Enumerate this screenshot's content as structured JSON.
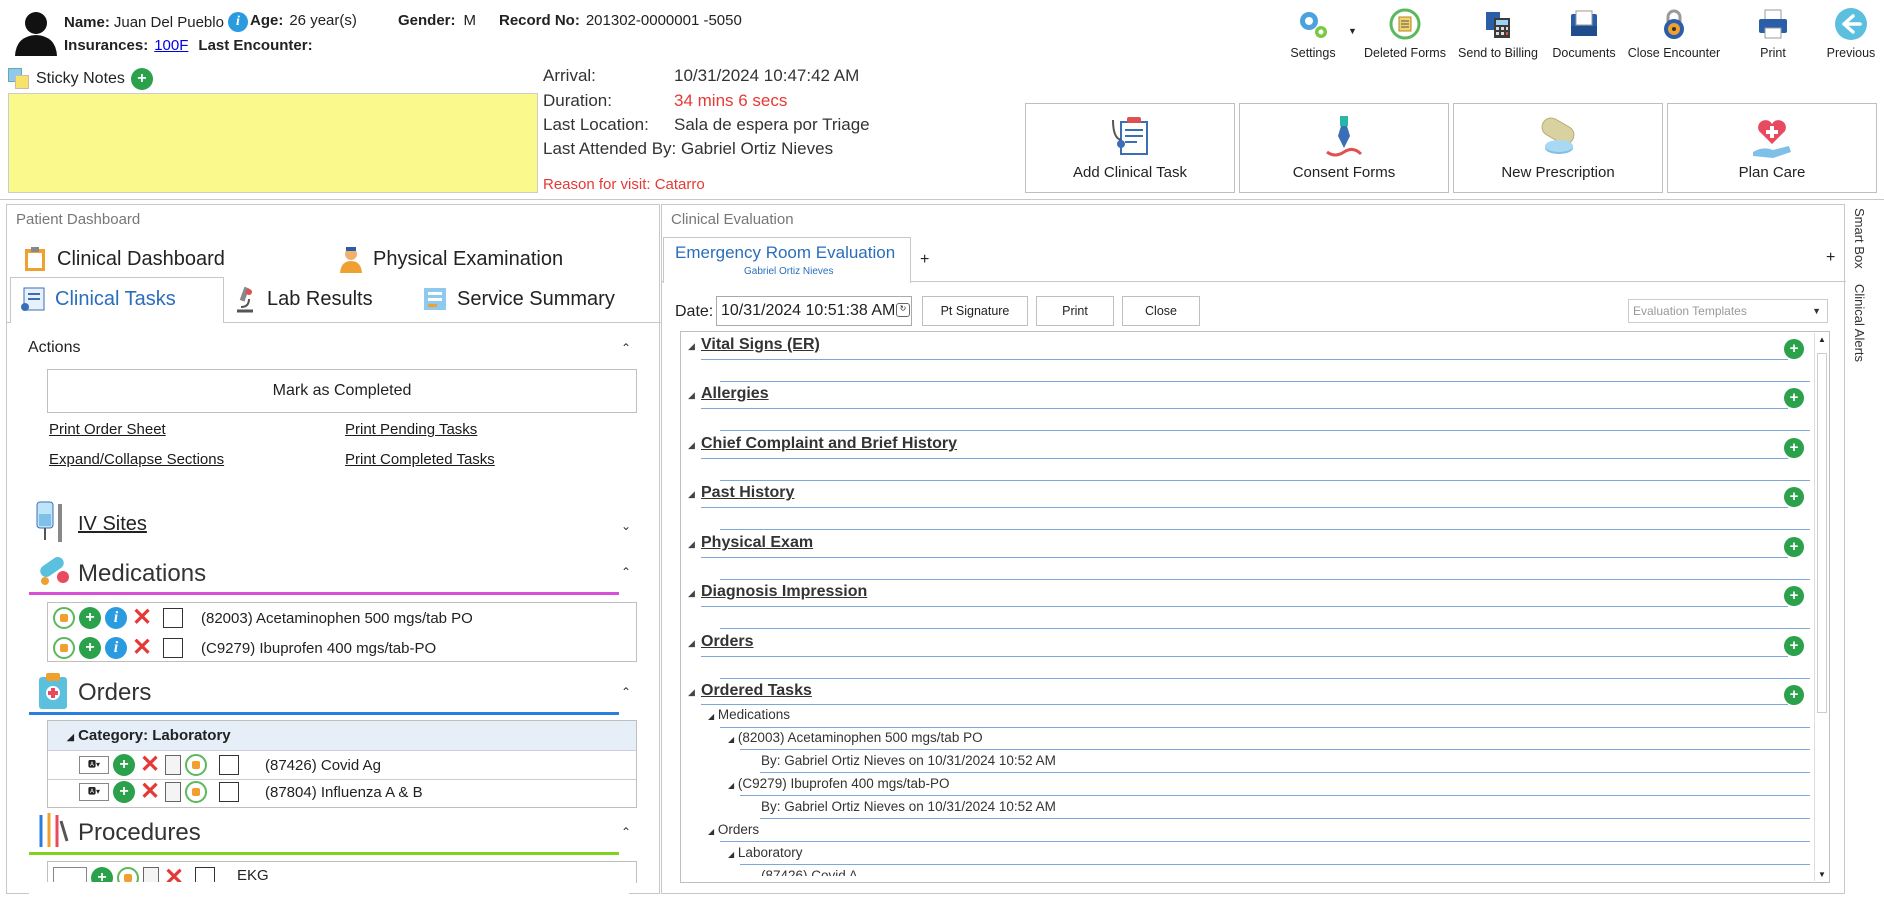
{
  "patient": {
    "name_label": "Name:",
    "name": "Juan Del Pueblo",
    "age_label": "Age:",
    "age": "26 year(s)",
    "gender_label": "Gender:",
    "gender": "M",
    "record_label": "Record No:",
    "record": "201302-0000001 -5050",
    "insurances_label": "Insurances:",
    "insurances": "100F",
    "last_encounter_label": "Last Encounter:"
  },
  "toolbar": {
    "settings": "Settings",
    "deleted_forms": "Deleted Forms",
    "send_to_billing": "Send to Billing",
    "documents": "Documents",
    "close_encounter": "Close Encounter",
    "print": "Print",
    "previous": "Previous"
  },
  "sticky_notes": {
    "label": "Sticky Notes"
  },
  "visit": {
    "arrival_label": "Arrival:",
    "arrival": "10/31/2024 10:47:42 AM",
    "duration_label": "Duration:",
    "duration": "34 mins 6 secs",
    "last_location_label": "Last Location:",
    "last_location": "Sala de espera por Triage",
    "last_attended": "Last Attended By: Gabriel Ortiz Nieves",
    "reason": "Reason for visit: Catarro"
  },
  "actions_bar": {
    "add_clinical_task": "Add Clinical Task",
    "consent_forms": "Consent Forms",
    "new_prescription": "New Prescription",
    "plan_care": "Plan Care"
  },
  "dashboard": {
    "title": "Patient Dashboard",
    "tabs": {
      "clinical_dashboard": "Clinical Dashboard",
      "physical_examination": "Physical Examination",
      "clinical_tasks": "Clinical Tasks",
      "lab_results": "Lab Results",
      "service_summary": "Service Summary"
    },
    "actions_title": "Actions",
    "mark_completed": "Mark as Completed",
    "links": {
      "print_order_sheet": "Print Order Sheet",
      "print_pending_tasks": "Print Pending Tasks",
      "expand_collapse": "Expand/Collapse Sections",
      "print_completed_tasks": "Print Completed Tasks"
    },
    "iv_sites": "IV Sites",
    "medications_title": "Medications",
    "medications": [
      "(82003) Acetaminophen 500 mgs/tab PO",
      "(C9279) Ibuprofen 400 mgs/tab-PO"
    ],
    "orders_title": "Orders",
    "orders_category": "Category: Laboratory",
    "orders": [
      "(87426) Covid Ag",
      "(87804) Influenza A & B"
    ],
    "procedures_title": "Procedures",
    "procedures_partial": "EKG"
  },
  "evaluation": {
    "title": "Clinical Evaluation",
    "tab_title": "Emergency Room Evaluation",
    "tab_subtitle": "Gabriel Ortiz Nieves",
    "tab_add": "+",
    "panel_add": "+",
    "date_label": "Date:",
    "date_value": "10/31/2024 10:51:38 AM",
    "pt_signature": "Pt Signature",
    "print": "Print",
    "close": "Close",
    "templates_placeholder": "Evaluation Templates",
    "sections": [
      "Vital Signs (ER)",
      "Allergies",
      "Chief Complaint and Brief History",
      "Past History",
      "Physical Exam",
      "Diagnosis Impression",
      "Orders",
      "Ordered Tasks"
    ],
    "ordered_tasks": {
      "medications": "Medications",
      "med1": "(82003) Acetaminophen 500 mgs/tab PO",
      "med1_by": "By: Gabriel Ortiz Nieves on 10/31/2024 10:52 AM",
      "med2": "(C9279) Ibuprofen 400 mgs/tab-PO",
      "med2_by": "By: Gabriel Ortiz Nieves on 10/31/2024 10:52 AM",
      "orders": "Orders",
      "laboratory": "Laboratory",
      "partial": "(87426) Covid A..."
    }
  },
  "right_rail": {
    "smart_box": "Smart Box",
    "clinical_alerts": "Clinical Alerts"
  }
}
